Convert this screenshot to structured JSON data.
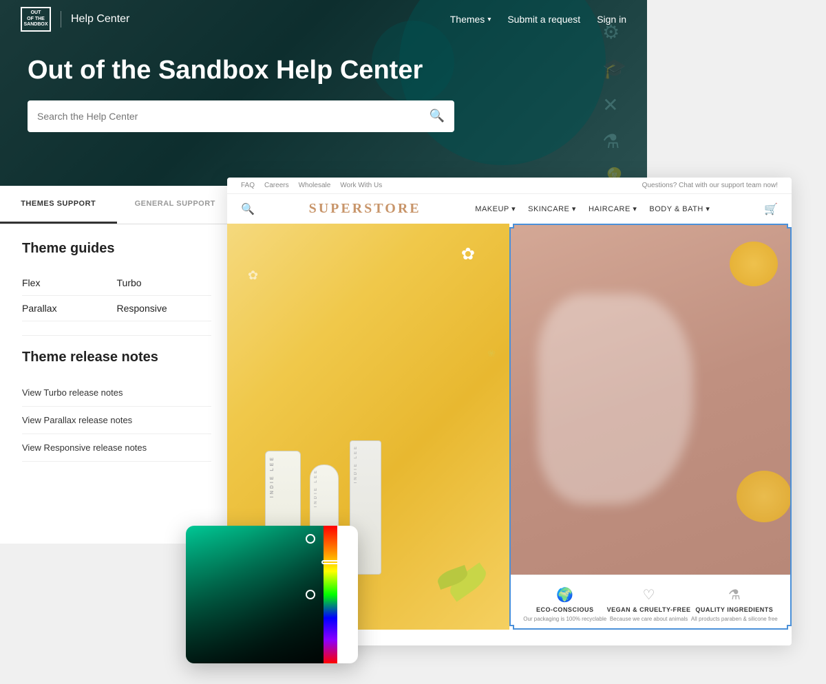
{
  "app": {
    "logo_line1": "OUT",
    "logo_line2": "OF THE",
    "logo_line3": "SANDBOX",
    "title": "Help Center"
  },
  "navbar": {
    "themes_label": "Themes",
    "submit_label": "Submit a request",
    "sign_in_label": "Sign in"
  },
  "hero": {
    "title": "Out of the Sandbox Help Center",
    "search_placeholder": "Search the Help Center"
  },
  "tabs": {
    "themes_support": "Themes Support",
    "general_support": "General Support"
  },
  "theme_guides": {
    "heading": "Theme guides",
    "links": [
      {
        "label": "Flex"
      },
      {
        "label": "Turbo"
      },
      {
        "label": "Parallax"
      },
      {
        "label": "Responsive"
      }
    ]
  },
  "release_notes": {
    "heading": "Theme release notes",
    "links": [
      {
        "label": "View Turbo release notes"
      },
      {
        "label": "View Parallax release notes"
      },
      {
        "label": "View Responsive release notes"
      }
    ]
  },
  "superstore": {
    "title": "SUPERSTORE",
    "toplinks": [
      "FAQ",
      "Careers",
      "Wholesale",
      "Work With Us"
    ],
    "support_text": "Questions? Chat with our support team now!",
    "nav_links": [
      {
        "label": "MAKEUP ▾"
      },
      {
        "label": "SKINCARE ▾"
      },
      {
        "label": "HAIRCARE ▾"
      },
      {
        "label": "BODY & BATH ▾"
      }
    ],
    "features": [
      {
        "icon": "🌍",
        "label": "ECO-CONSCIOUS",
        "desc": "Our packaging is 100% recyclable"
      },
      {
        "icon": "♡",
        "label": "VEGAN & CRUELTY-FREE",
        "desc": "Because we care about animals"
      },
      {
        "icon": "⚗",
        "label": "QUALITY INGREDIENTS",
        "desc": "All products paraben & silicone free"
      }
    ],
    "brand_text": "INDIE LEE"
  }
}
